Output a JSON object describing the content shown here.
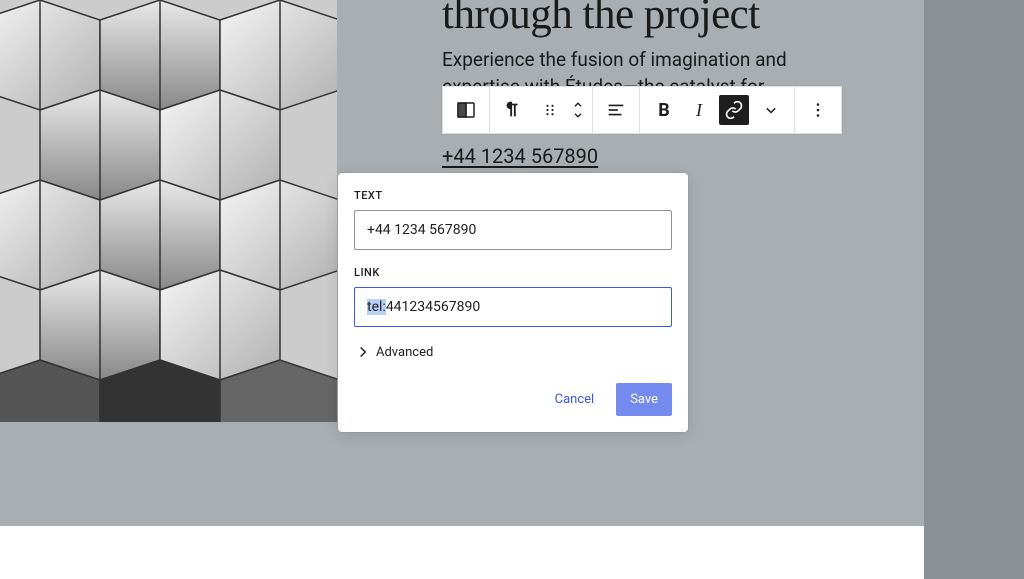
{
  "heading": "through the project",
  "body_text": "Experience the fusion of imagination and expertise with Études—the catalyst for architectural",
  "phone_display": "+44 1234 567890",
  "popover": {
    "text_label": "TEXT",
    "text_value": "+44 1234 567890",
    "link_label": "LINK",
    "link_prefix": "tel:",
    "link_rest": "441234567890",
    "advanced_label": "Advanced",
    "cancel_label": "Cancel",
    "save_label": "Save"
  },
  "toolbar": {
    "bold": "B",
    "italic": "I"
  }
}
